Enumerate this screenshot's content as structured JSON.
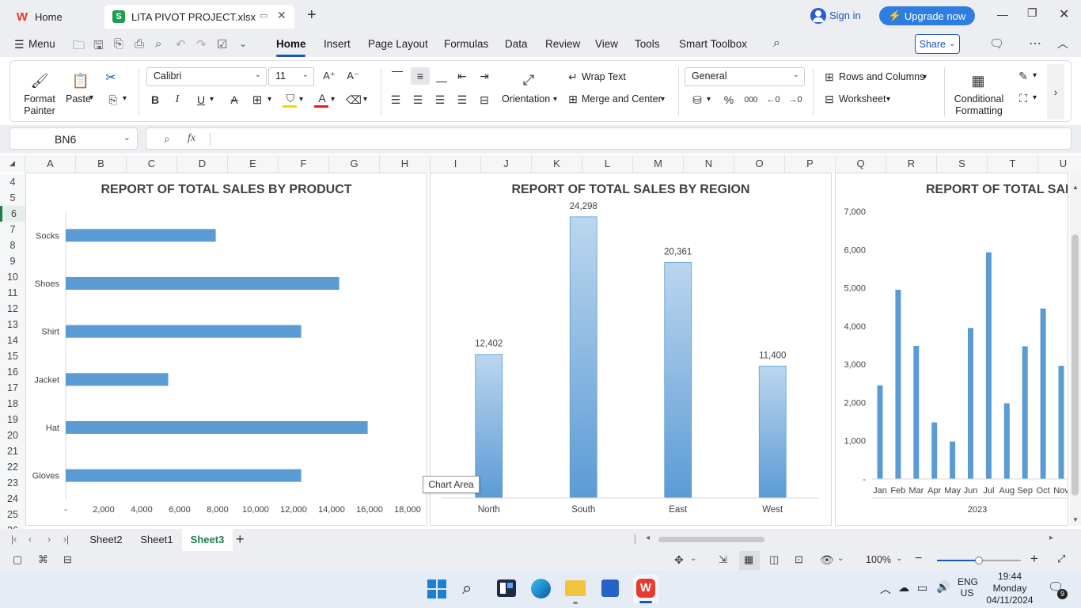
{
  "titlebar": {
    "tabs": [
      {
        "label": "Home",
        "badge": "W"
      },
      {
        "label": "LITA PIVOT PROJECT.xlsx",
        "badge": "S"
      }
    ],
    "sign_in": "Sign in",
    "upgrade": "Upgrade now"
  },
  "menubar": {
    "menu_label": "Menu",
    "items": [
      "Home",
      "Insert",
      "Page Layout",
      "Formulas",
      "Data",
      "Review",
      "View",
      "Tools",
      "Smart Toolbox"
    ],
    "share": "Share"
  },
  "ribbon": {
    "format_painter": "Format Painter",
    "paste": "Paste",
    "font": "Calibri",
    "font_size": "11",
    "wrap_text": "Wrap Text",
    "orientation": "Orientation",
    "merge_center": "Merge and Center",
    "number_format": "General",
    "rows_columns": "Rows and Columns",
    "worksheet": "Worksheet",
    "conditional_formatting": "Conditional Formatting",
    "percent": "%",
    "thousands": "000"
  },
  "formula_bar": {
    "name_box": "BN6",
    "fx": "fx",
    "content": ""
  },
  "columns": [
    "A",
    "B",
    "C",
    "D",
    "E",
    "F",
    "G",
    "H",
    "I",
    "J",
    "K",
    "L",
    "M",
    "N",
    "O",
    "P",
    "Q",
    "R",
    "S",
    "T",
    "U"
  ],
  "rows": [
    "4",
    "5",
    "6",
    "7",
    "8",
    "9",
    "10",
    "11",
    "12",
    "13",
    "14",
    "15",
    "16",
    "17",
    "18",
    "19",
    "20",
    "21",
    "22",
    "23",
    "24",
    "25",
    "26"
  ],
  "chart_area_tooltip": "Chart Area",
  "chart_data": [
    {
      "type": "bar",
      "orientation": "horizontal",
      "title": "REPORT OF TOTAL SALES BY PRODUCT",
      "categories": [
        "Socks",
        "Shoes",
        "Shirt",
        "Jacket",
        "Hat",
        "Gloves"
      ],
      "values": [
        7900,
        14400,
        12400,
        5400,
        15900,
        12400
      ],
      "xlim": [
        0,
        18000
      ],
      "xticks": [
        "-",
        "2,000",
        "4,000",
        "6,000",
        "8,000",
        "10,000",
        "12,000",
        "14,000",
        "16,000",
        "18,000"
      ],
      "color": "#5b9bd5"
    },
    {
      "type": "bar",
      "title": "REPORT OF TOTAL SALES BY REGION",
      "categories": [
        "North",
        "South",
        "East",
        "West"
      ],
      "values": [
        12402,
        24298,
        20361,
        11400
      ],
      "labels": [
        "12,402",
        "24,298",
        "20,361",
        "11,400"
      ],
      "ylim": [
        0,
        26000
      ],
      "color_top": "#bcd6ee",
      "color_bottom": "#5b9bd5"
    },
    {
      "type": "bar",
      "title": "REPORT OF TOTAL SALE",
      "categories": [
        "Jan",
        "Feb",
        "Mar",
        "Apr",
        "May",
        "Jun",
        "Jul",
        "Aug",
        "Sep",
        "Oct",
        "Nov"
      ],
      "values": [
        2450,
        4950,
        3480,
        1480,
        980,
        3950,
        5930,
        1980,
        3470,
        4460,
        2960
      ],
      "group_label": "2023",
      "ylim": [
        0,
        7000
      ],
      "yticks": [
        "-",
        "1,000",
        "2,000",
        "3,000",
        "4,000",
        "5,000",
        "6,000",
        "7,000"
      ],
      "color": "#5b9bd5"
    }
  ],
  "sheets": {
    "tabs": [
      "Sheet2",
      "Sheet1",
      "Sheet3"
    ],
    "active": "Sheet3"
  },
  "status": {
    "zoom": "100%",
    "zoom_level": 0.5
  },
  "taskbar": {
    "lang": "ENG",
    "region": "US",
    "time": "19:44",
    "day": "Monday",
    "date": "04/11/2024",
    "notifications": "9"
  },
  "colors": {
    "accent": "#1a56b8",
    "upgrade": "#2f7de1",
    "bar": "#5b9bd5",
    "sheet_active": "#1e7e4a"
  }
}
